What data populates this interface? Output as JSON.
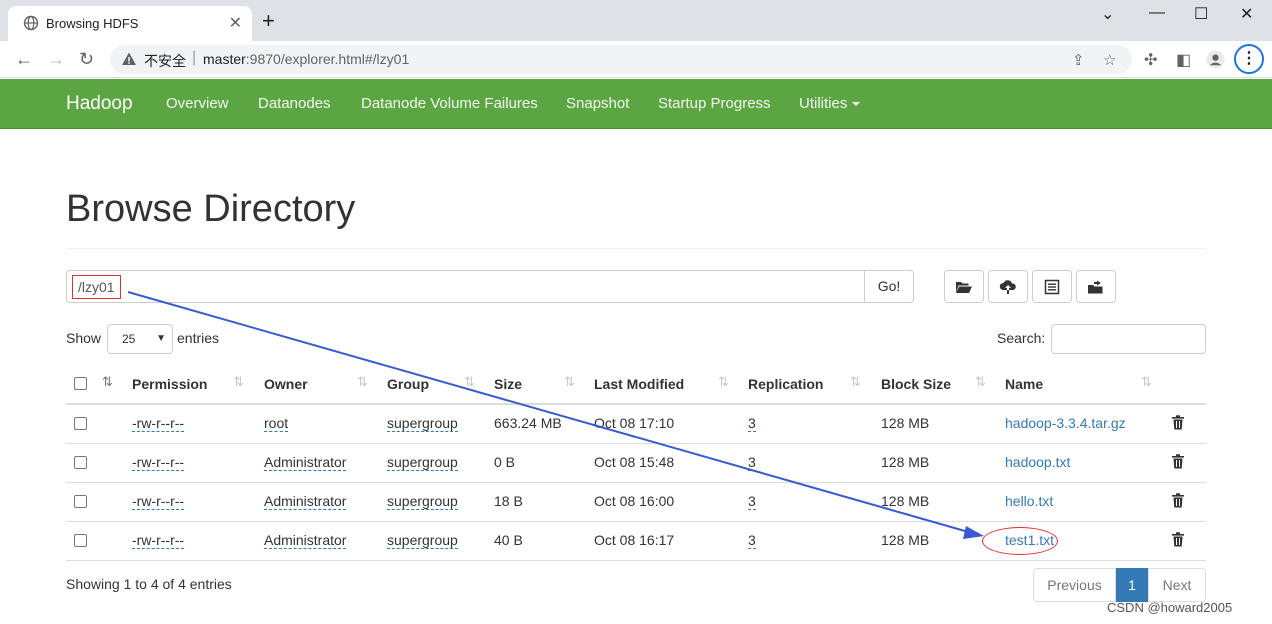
{
  "browser": {
    "tab_title": "Browsing HDFS",
    "tab_close": "✕",
    "new_tab": "+",
    "security_label": "不安全",
    "url_host": "master",
    "url_rest": ":9870/explorer.html#/lzy01",
    "window_minimize": "⌄",
    "window_min2": "—",
    "window_max": "☐",
    "window_close": "✕"
  },
  "navbar": {
    "brand": "Hadoop",
    "links": [
      "Overview",
      "Datanodes",
      "Datanode Volume Failures",
      "Snapshot",
      "Startup Progress",
      "Utilities"
    ]
  },
  "page": {
    "title": "Browse Directory",
    "directory_value": "/lzy01",
    "go_label": "Go!",
    "show_label": "Show",
    "entries_value": "25",
    "entries_label": "entries",
    "search_label": "Search:"
  },
  "table": {
    "headers": [
      "Permission",
      "Owner",
      "Group",
      "Size",
      "Last Modified",
      "Replication",
      "Block Size",
      "Name"
    ],
    "rows": [
      {
        "permission": "-rw-r--r--",
        "owner": "root",
        "group": "supergroup",
        "size": "663.24 MB",
        "modified": "Oct 08 17:10",
        "replication": "3",
        "block_size": "128 MB",
        "name": "hadoop-3.3.4.tar.gz"
      },
      {
        "permission": "-rw-r--r--",
        "owner": "Administrator",
        "group": "supergroup",
        "size": "0 B",
        "modified": "Oct 08 15:48",
        "replication": "3",
        "block_size": "128 MB",
        "name": "hadoop.txt"
      },
      {
        "permission": "-rw-r--r--",
        "owner": "Administrator",
        "group": "supergroup",
        "size": "18 B",
        "modified": "Oct 08 16:00",
        "replication": "3",
        "block_size": "128 MB",
        "name": "hello.txt"
      },
      {
        "permission": "-rw-r--r--",
        "owner": "Administrator",
        "group": "supergroup",
        "size": "40 B",
        "modified": "Oct 08 16:17",
        "replication": "3",
        "block_size": "128 MB",
        "name": "test1.txt"
      }
    ]
  },
  "footer": {
    "info": "Showing 1 to 4 of 4 entries",
    "previous": "Previous",
    "page": "1",
    "next": "Next"
  },
  "watermark": "CSDN @howard2005",
  "colors": {
    "navbar": "#5ba642",
    "link": "#337ab7",
    "annotation_red": "#e03030",
    "annotation_arrow": "#3a5bd0"
  }
}
